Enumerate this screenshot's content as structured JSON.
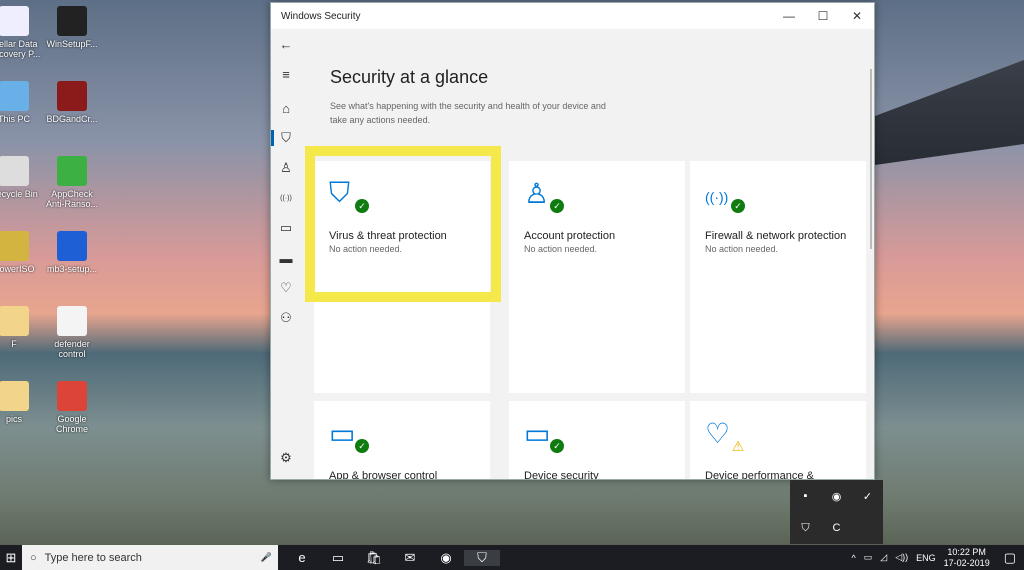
{
  "desktop": {
    "icons": [
      {
        "label": "Stellar Data Recovery P...",
        "color": "#eef"
      },
      {
        "label": "WinSetupF...",
        "color": "#222"
      },
      {
        "label": "This PC",
        "color": "#6ab0e8"
      },
      {
        "label": "BDGandCr...",
        "color": "#8b1a1a"
      },
      {
        "label": "Recycle Bin",
        "color": "#ddd"
      },
      {
        "label": "AppCheck Anti-Ranso...",
        "color": "#3cb043"
      },
      {
        "label": "PowerISO",
        "color": "#d4b440"
      },
      {
        "label": "mb3-setup...",
        "color": "#1f5fd6"
      },
      {
        "label": "F",
        "color": "#f2d58a"
      },
      {
        "label": "defender control",
        "color": "#f4f4f4"
      },
      {
        "label": "pics",
        "color": "#f2d58a"
      },
      {
        "label": "Google Chrome",
        "color": "#db4437"
      }
    ]
  },
  "window": {
    "title": "Windows Security",
    "minimize": "—",
    "maximize": "☐",
    "close": "✕"
  },
  "sidebar": [
    {
      "name": "back",
      "glyph": "←"
    },
    {
      "name": "menu",
      "glyph": "≡"
    },
    {
      "name": "home",
      "glyph": "⌂"
    },
    {
      "name": "virus-protection",
      "glyph": "⛉",
      "active": true
    },
    {
      "name": "account",
      "glyph": "♙"
    },
    {
      "name": "firewall",
      "glyph": "((·))"
    },
    {
      "name": "app-browser",
      "glyph": "▭"
    },
    {
      "name": "device-security",
      "glyph": "▬"
    },
    {
      "name": "device-health",
      "glyph": "♡"
    },
    {
      "name": "family",
      "glyph": "⚇"
    },
    {
      "name": "settings",
      "glyph": "⚙"
    }
  ],
  "main": {
    "title": "Security at a glance",
    "description": "See what's happening with the security and health of your device and take any actions needed.",
    "cards": [
      {
        "title": "Virus & threat protection",
        "status": "No action needed.",
        "glyph": "⛉",
        "badge": "✓"
      },
      {
        "title": "Account protection",
        "status": "No action needed.",
        "glyph": "♙",
        "badge": "✓"
      },
      {
        "title": "Firewall & network protection",
        "status": "No action needed.",
        "glyph": "((·))",
        "badge": "✓"
      },
      {
        "title": "App & browser control",
        "status": "",
        "glyph": "▭",
        "badge": "✓"
      },
      {
        "title": "Device security",
        "status": "",
        "glyph": "▭",
        "badge": "✓"
      },
      {
        "title": "Device performance &",
        "status": "",
        "glyph": "♡",
        "badge": "⚠"
      }
    ]
  },
  "taskbar": {
    "start": "⊞",
    "search_placeholder": "Type here to search",
    "mic": "🎤",
    "apps": [
      "e",
      "▭",
      "🛍",
      "✉",
      "◉",
      "⛉"
    ],
    "tray": {
      "chevron": "^",
      "battery": "▭",
      "wifi": "◿",
      "volume": "◁))",
      "lang": "ENG",
      "time": "10:22 PM",
      "date": "17-02-2019",
      "notifications": "▢"
    }
  },
  "flyout": [
    "▪",
    "◉",
    "✓",
    "⛉",
    "C"
  ]
}
